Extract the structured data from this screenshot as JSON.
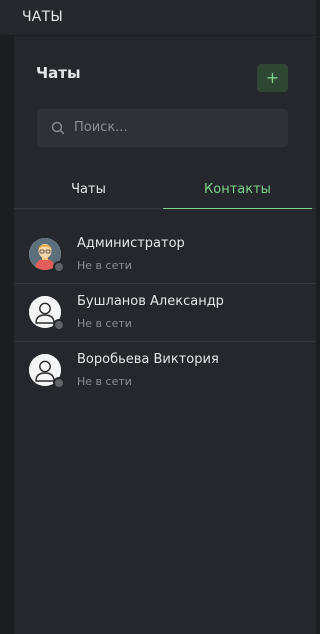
{
  "header": {
    "title": "ЧАТЫ"
  },
  "panel": {
    "title": "Чаты",
    "add_label": "+",
    "search": {
      "placeholder": "Поиск..."
    },
    "tabs": [
      {
        "label": "Чаты",
        "active": false
      },
      {
        "label": "Контакты",
        "active": true
      }
    ],
    "contacts": [
      {
        "name": "Администратор",
        "status": "Не в сети",
        "avatar": "admin-avatar-icon"
      },
      {
        "name": "Бушланов Александр",
        "status": "Не в сети",
        "avatar": "user-avatar-icon"
      },
      {
        "name": "Воробьева Виктория",
        "status": "Не в сети",
        "avatar": "user-avatar-icon"
      }
    ]
  },
  "colors": {
    "accent": "#7fd18b",
    "background": "#24272b",
    "offline_dot": "#5f6368"
  }
}
